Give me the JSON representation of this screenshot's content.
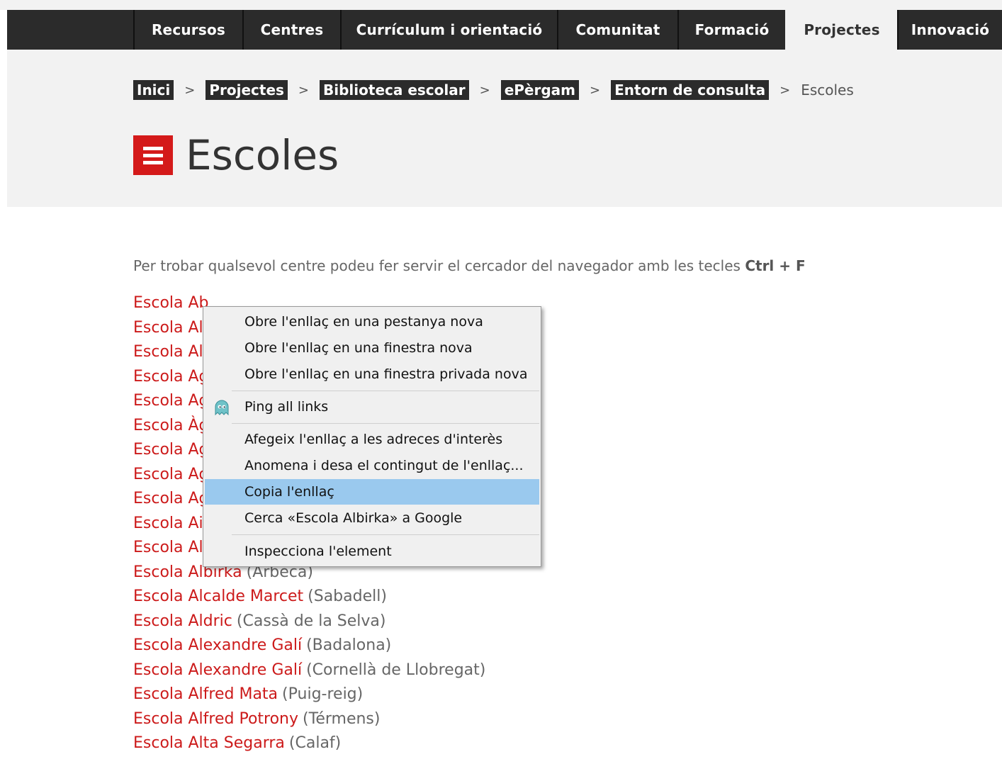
{
  "nav": {
    "items": [
      "Recursos",
      "Centres",
      "Currículum i orientació",
      "Comunitat",
      "Formació",
      "Projectes",
      "Innovació"
    ],
    "active": "Projectes"
  },
  "breadcrumb": {
    "links": [
      "Inici",
      "Projectes",
      "Biblioteca escolar",
      "ePèrgam",
      "Entorn de consulta"
    ],
    "separator": ">",
    "current": "Escoles"
  },
  "page": {
    "title": "Escoles",
    "menu_icon": "hamburger-icon"
  },
  "intro": {
    "text": "Per trobar qualsevol centre podeu fer servir el cercador del navegador amb les tecles",
    "keys": "Ctrl + F"
  },
  "schools": [
    {
      "name": "Escola Ab",
      "town": ""
    },
    {
      "name": "Escola Al",
      "town": ""
    },
    {
      "name": "Escola Al",
      "town": ""
    },
    {
      "name": "Escola Ag",
      "town": ""
    },
    {
      "name": "Escola Ag",
      "town": ""
    },
    {
      "name": "Escola Àg",
      "town": ""
    },
    {
      "name": "Escola Ag",
      "town": ""
    },
    {
      "name": "Escola Ag",
      "town": ""
    },
    {
      "name": "Escola Ag",
      "town": ""
    },
    {
      "name": "Escola Ai",
      "town": ""
    },
    {
      "name": "Escola Al",
      "town": ""
    },
    {
      "name": "Escola Albirka",
      "town": "(Arbeca)"
    },
    {
      "name": "Escola Alcalde Marcet",
      "town": "(Sabadell)"
    },
    {
      "name": "Escola Aldric",
      "town": "(Cassà de la Selva)"
    },
    {
      "name": "Escola Alexandre Galí",
      "town": "(Badalona)"
    },
    {
      "name": "Escola Alexandre Galí",
      "town": "(Cornellà de Llobregat)"
    },
    {
      "name": "Escola Alfred Mata",
      "town": "(Puig-reig)"
    },
    {
      "name": "Escola Alfred Potrony",
      "town": "(Térmens)"
    },
    {
      "name": "Escola Alta Segarra",
      "town": "(Calaf)"
    }
  ],
  "context_menu": {
    "items": [
      "Obre l'enllaç en una pestanya nova",
      "Obre l'enllaç en una finestra nova",
      "Obre l'enllaç en una finestra privada nova",
      "Ping all links",
      "Afegeix l'enllaç a les adreces d'interès",
      "Anomena i desa el contingut de l'enllaç...",
      "Copia l'enllaç",
      "Cerca «Escola Albirka» a Google",
      "Inspecciona l'element"
    ],
    "highlighted": "Copia l'enllaç",
    "ping_icon": "ghost-icon",
    "highlight_color": "#9ac9ee"
  },
  "colors": {
    "accent": "#d41a1a",
    "link": "#cc1a1a",
    "nav_bg": "#2b2b2b"
  }
}
